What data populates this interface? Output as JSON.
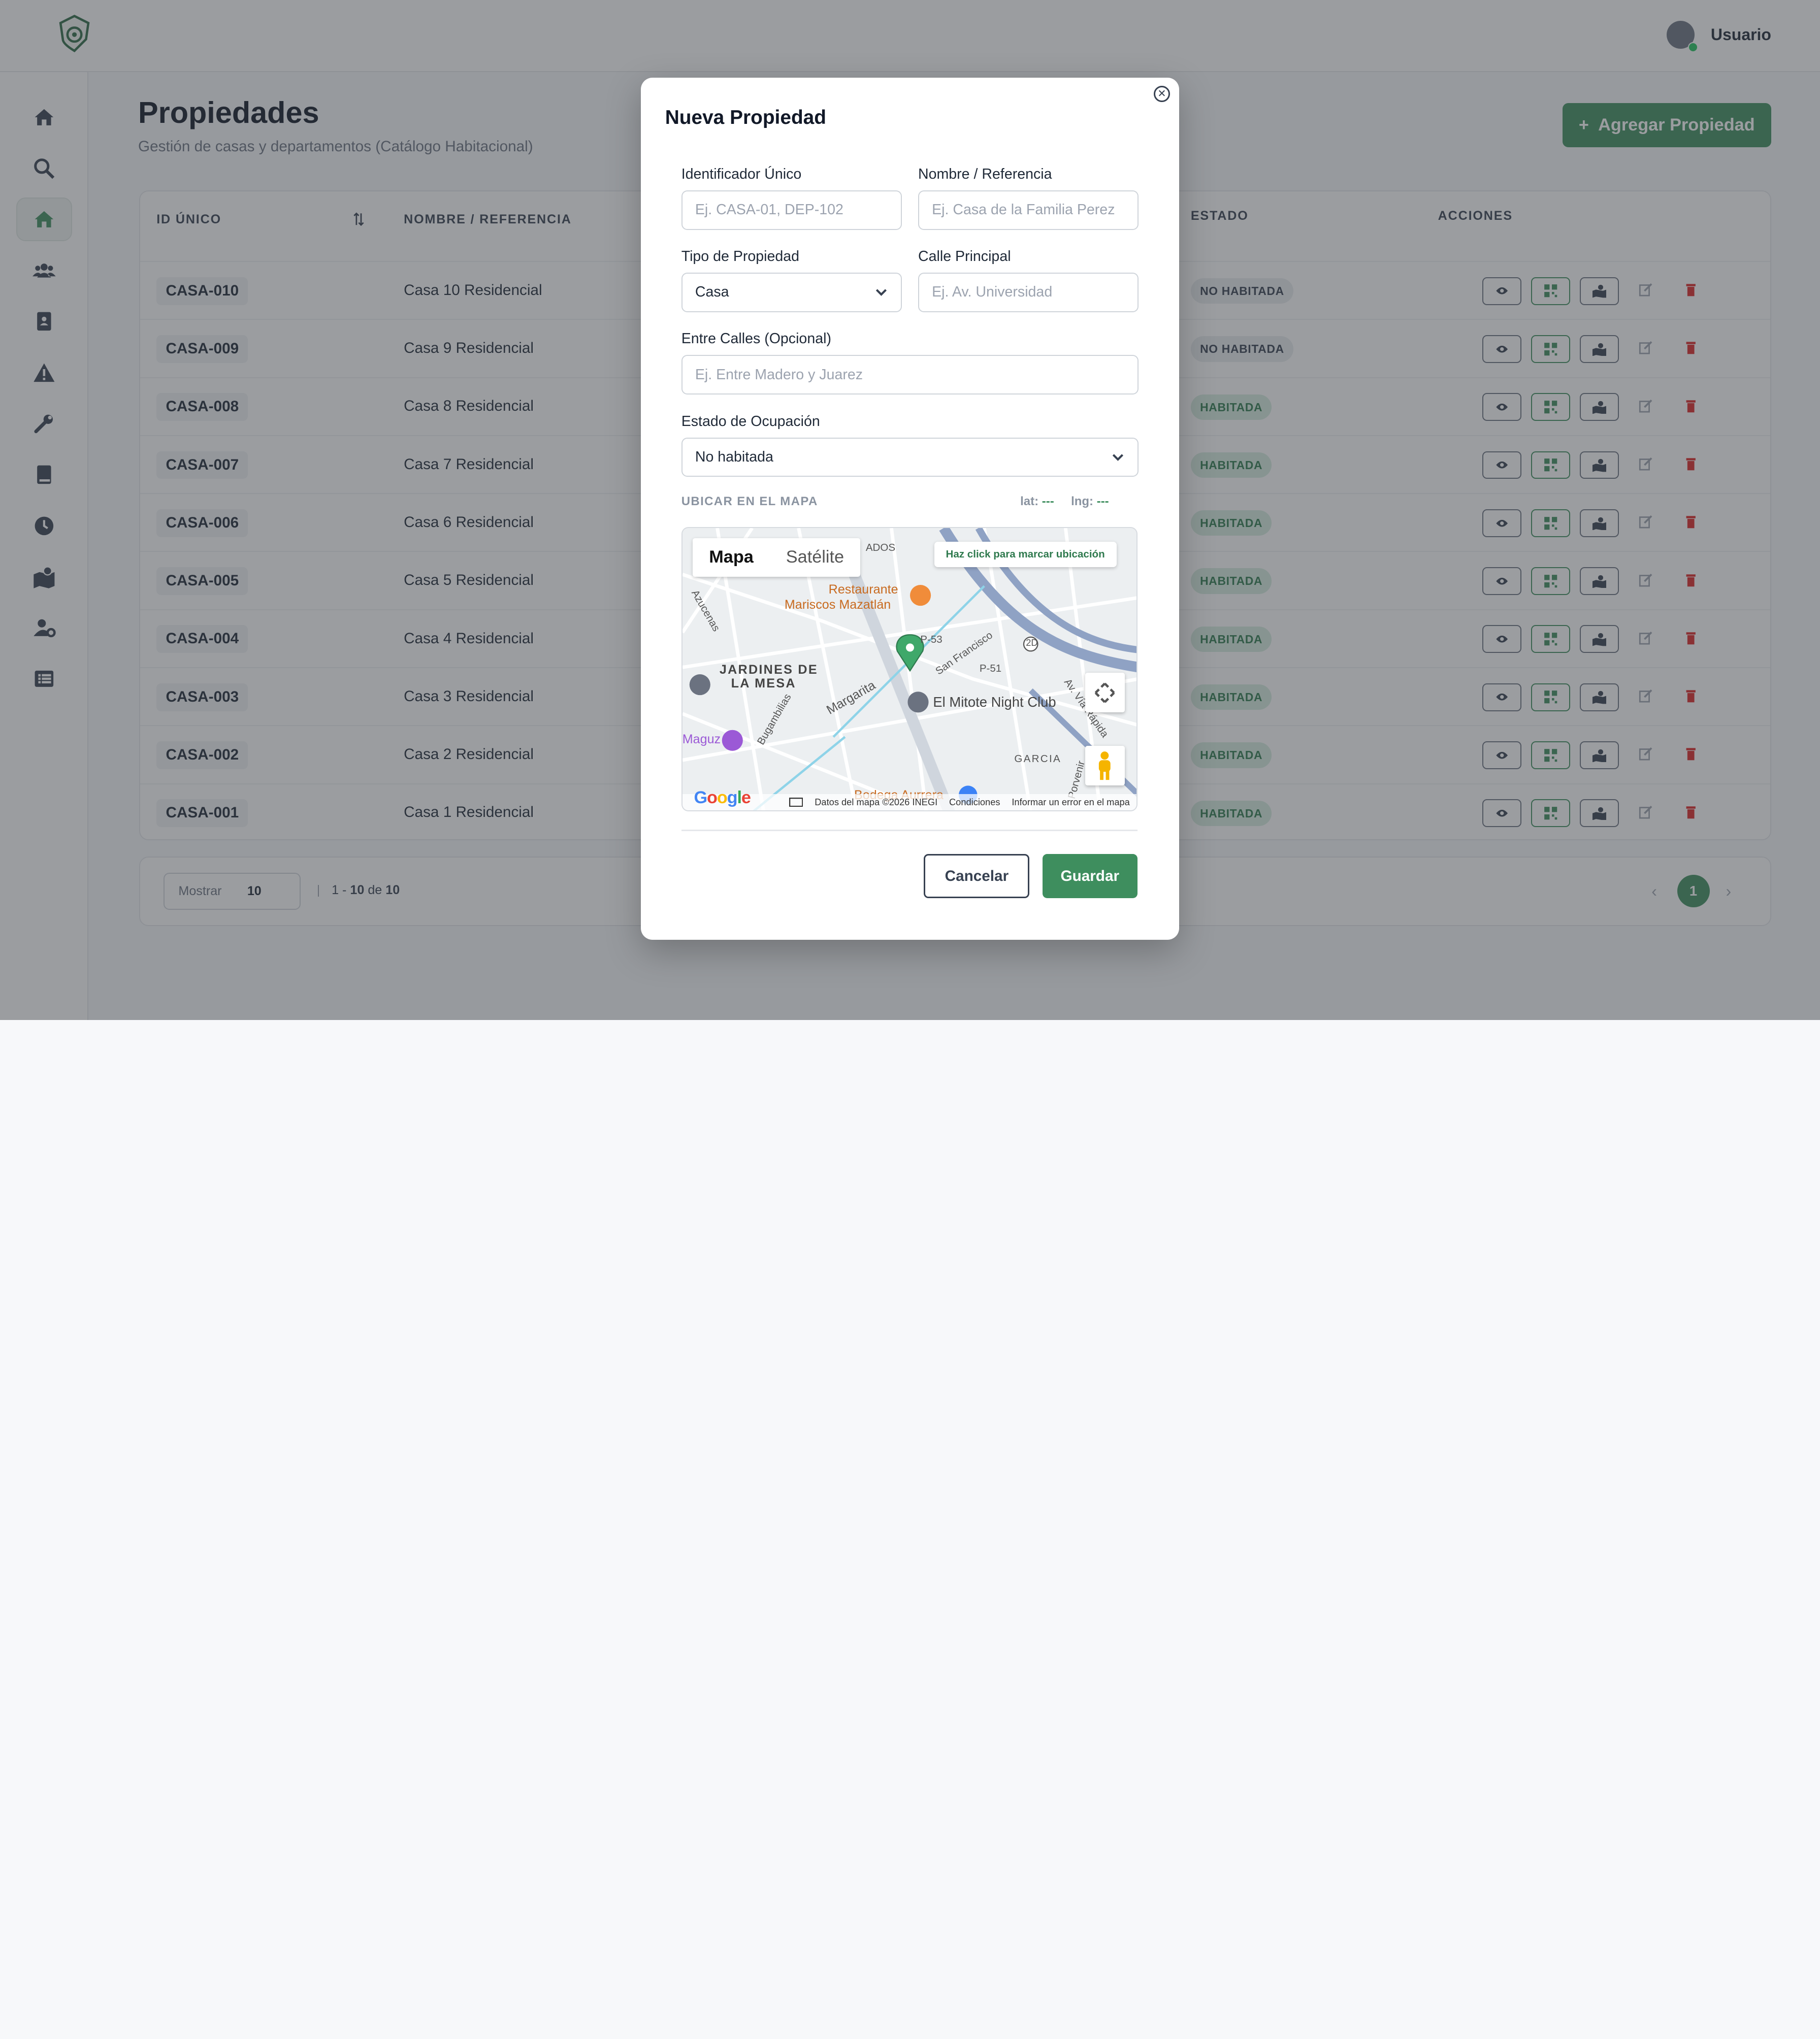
{
  "header": {
    "user_name": "Usuario"
  },
  "page": {
    "title": "Propiedades",
    "subtitle": "Gestión de casas y departamentos (Catálogo Habitacional)",
    "add_button": "Agregar Propiedad"
  },
  "table": {
    "columns": [
      "ID ÚNICO",
      "NOMBRE / REFERENCIA",
      "ESTADO",
      "ACCIONES"
    ],
    "rows": [
      {
        "id": "CASA-010",
        "name": "Casa 10 Residencial",
        "status": "NO HABITADA"
      },
      {
        "id": "CASA-009",
        "name": "Casa 9 Residencial",
        "status": "NO HABITADA"
      },
      {
        "id": "CASA-008",
        "name": "Casa 8 Residencial",
        "status": "HABITADA"
      },
      {
        "id": "CASA-007",
        "name": "Casa 7 Residencial",
        "status": "HABITADA"
      },
      {
        "id": "CASA-006",
        "name": "Casa 6 Residencial",
        "status": "HABITADA"
      },
      {
        "id": "CASA-005",
        "name": "Casa 5 Residencial",
        "status": "HABITADA"
      },
      {
        "id": "CASA-004",
        "name": "Casa 4 Residencial",
        "status": "HABITADA"
      },
      {
        "id": "CASA-003",
        "name": "Casa 3 Residencial",
        "status": "HABITADA"
      },
      {
        "id": "CASA-002",
        "name": "Casa 2 Residencial",
        "status": "HABITADA"
      },
      {
        "id": "CASA-001",
        "name": "Casa 1 Residencial",
        "status": "HABITADA"
      }
    ]
  },
  "pagination": {
    "show_label": "Mostrar",
    "page_size": "10",
    "range_start": "1",
    "range_end": "10",
    "range_of": "de",
    "total": "10",
    "current_page": "1"
  },
  "modal": {
    "title": "Nueva Propiedad",
    "fields": {
      "identifier": {
        "label": "Identificador Único",
        "placeholder": "Ej. CASA-01, DEP-102"
      },
      "name": {
        "label": "Nombre / Referencia",
        "placeholder": "Ej. Casa de la Familia Perez"
      },
      "type": {
        "label": "Tipo de Propiedad",
        "value": "Casa"
      },
      "street": {
        "label": "Calle Principal",
        "placeholder": "Ej. Av. Universidad"
      },
      "between": {
        "label": "Entre Calles (Opcional)",
        "placeholder": "Ej. Entre Madero y Juarez"
      },
      "occupancy": {
        "label": "Estado de Ocupación",
        "value": "No habitada"
      }
    },
    "map": {
      "section_label": "UBICAR EN EL MAPA",
      "lat_label": "lat:",
      "lat_value": "---",
      "lng_label": "lng:",
      "lng_value": "---",
      "tab_map": "Mapa",
      "tab_satellite": "Satélite",
      "hint": "Haz click para marcar ubicación",
      "places": {
        "restaurant": "Restaurante",
        "restaurant2": "Mariscos Mazatlán",
        "club": "El Mitote Night Club",
        "district1": "JARDINES DE",
        "district2": "LA MESA",
        "street_margarita": "Margarita",
        "street_sanfrancisco": "San Francisco",
        "street_bugambilias": "Bugambilias",
        "street_azucenas": "Azucenas",
        "street_viarapida": "Av. Vía Rápida",
        "street_porvenir": "Porvenir",
        "garcia": "GARCIA",
        "p51": "P-51",
        "p53": "P-53",
        "route": "2D",
        "bodega": "Bodega Aurrera",
        "maguz": "Maguz",
        "dados": "ADOS"
      },
      "footer_data": "Datos del mapa ©2026 INEGI",
      "footer_terms": "Condiciones",
      "footer_report": "Informar un error en el mapa",
      "google": "Google"
    },
    "cancel": "Cancelar",
    "save": "Guardar"
  },
  "colors": {
    "accent": "#3e8e5e",
    "danger": "#dc2626"
  }
}
